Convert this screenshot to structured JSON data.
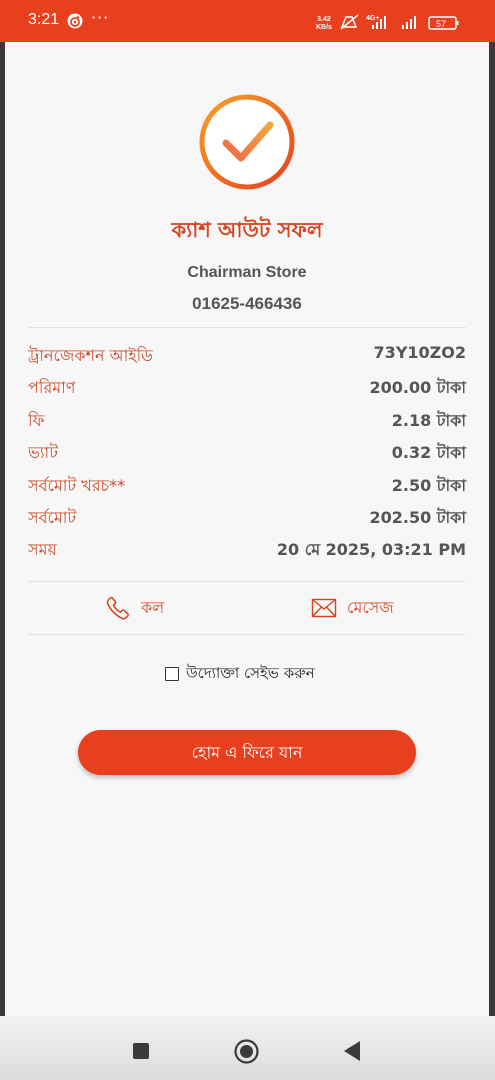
{
  "status_bar": {
    "time": "3:21",
    "more": "···",
    "speed_value": "3.42",
    "speed_unit": "KB/s",
    "network": "4G+",
    "battery": "57",
    "background_color": "#e8401f"
  },
  "result": {
    "title": "ক্যাশ আউট সফল",
    "merchant_name": "Chairman Store",
    "merchant_phone": "01625-466436",
    "icon": "check-circle-icon"
  },
  "details": [
    {
      "label": "ট্রানজেকশন আইডি",
      "value": "73Y10ZO2"
    },
    {
      "label": "পরিমাণ",
      "value": "200.00 টাকা"
    },
    {
      "label": "ফি",
      "value": "2.18 টাকা"
    },
    {
      "label": "ভ্যাট",
      "value": "0.32 টাকা"
    },
    {
      "label": "সর্বমোট খরচ**",
      "value": "2.50 টাকা"
    },
    {
      "label": "সর্বমোট",
      "value": "202.50 টাকা"
    },
    {
      "label": "সময়",
      "value": "20 মে 2025, 03:21 PM"
    }
  ],
  "actions": {
    "call_label": "কল",
    "call_icon": "phone-icon",
    "message_label": "মেসেজ",
    "message_icon": "envelope-icon"
  },
  "save_merchant": {
    "label": "উদ্যোক্তা সেইভ করুন",
    "checked": false
  },
  "home_button": {
    "label": "হোম এ ফিরে যান"
  },
  "colors": {
    "accent": "#e8401f",
    "label_text": "#c94a2a",
    "value_text": "#555555"
  }
}
